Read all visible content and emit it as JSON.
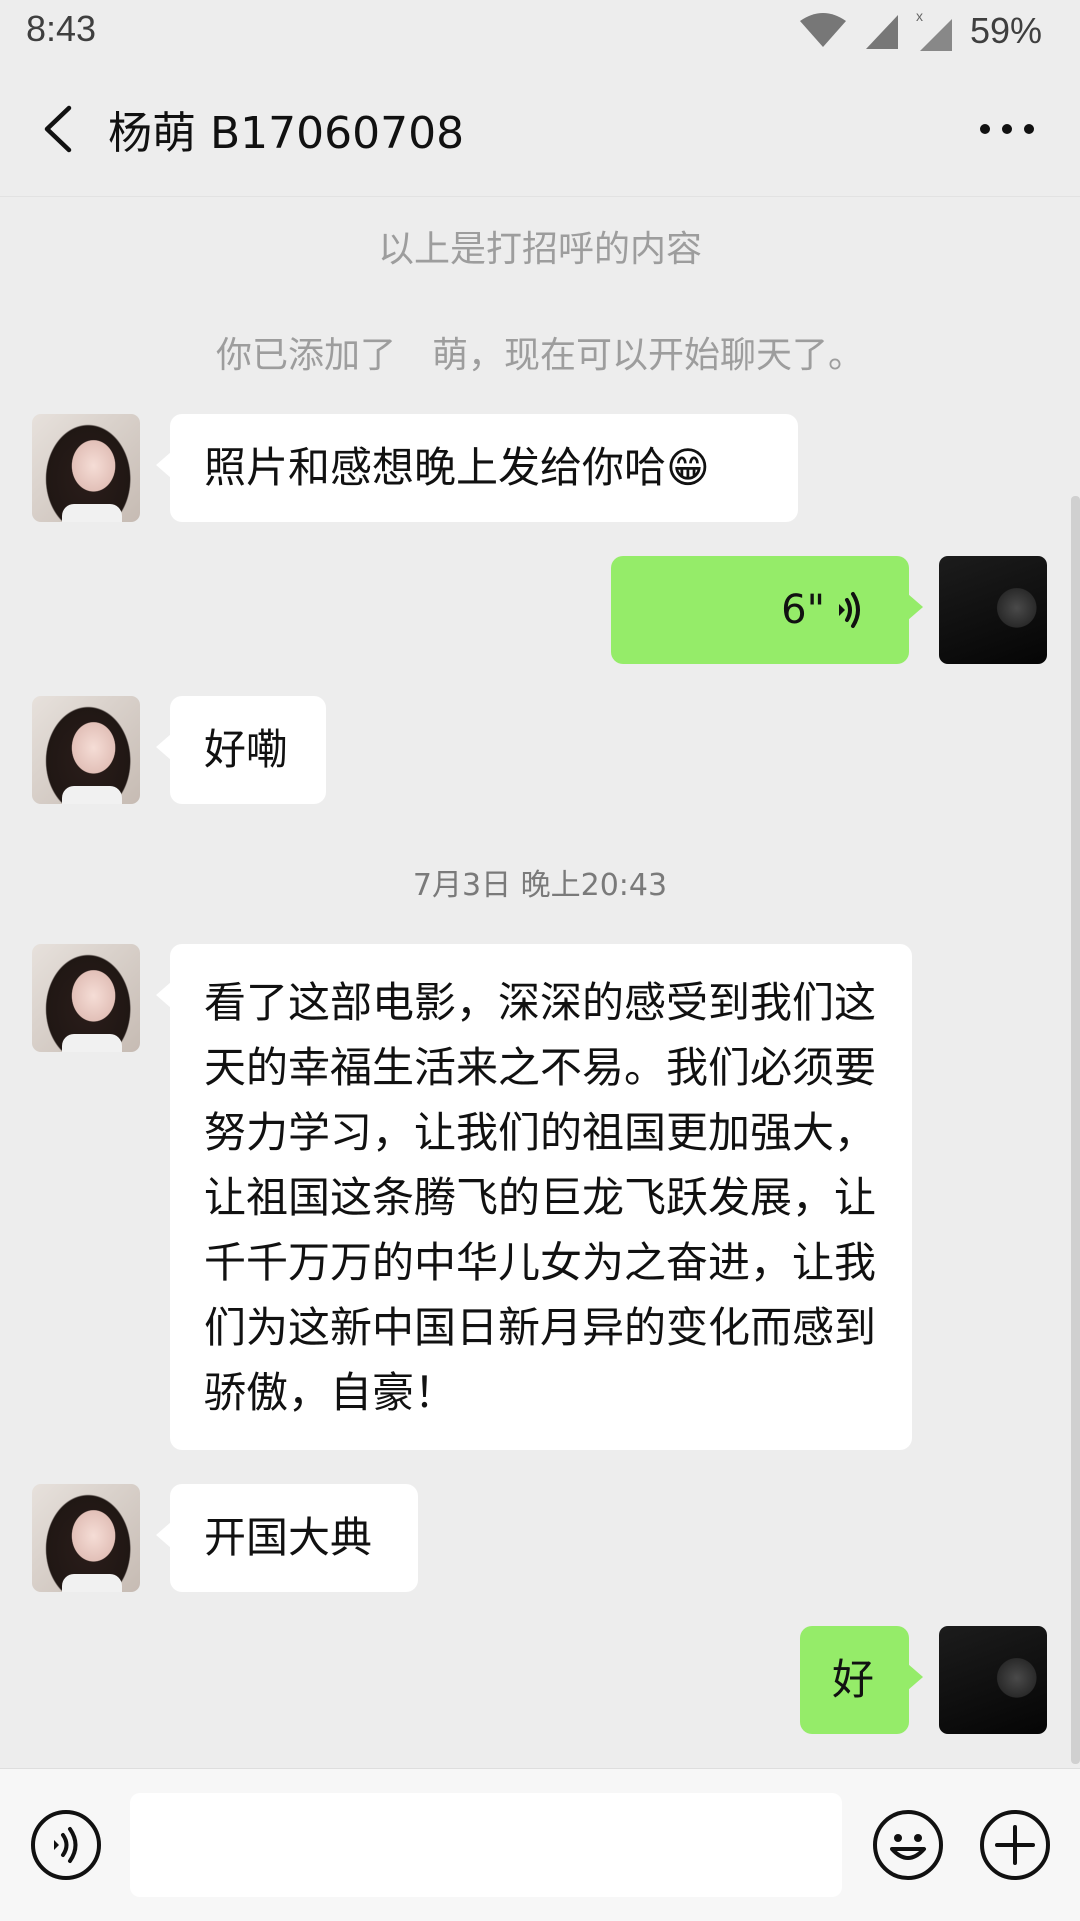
{
  "status_bar": {
    "time": "8:43",
    "battery": "59%"
  },
  "header": {
    "title": "杨萌 B17060708"
  },
  "system_notes": {
    "greeting_note": "以上是打招呼的内容",
    "added_note": "你已添加了　萌，现在可以开始聊天了。"
  },
  "timestamp": "7月3日 晚上20:43",
  "messages": [
    {
      "direction": "in",
      "type": "text",
      "text": "照片和感想晚上发给你哈😁"
    },
    {
      "direction": "out",
      "type": "voice",
      "duration": "6\""
    },
    {
      "direction": "in",
      "type": "text",
      "text": "好嘞"
    },
    {
      "direction": "in",
      "type": "text",
      "text": "看了这部电影，深深的感受到我们这天的幸福生活来之不易。我们必须要努力学习，让我们的祖国更加强大，让祖国这条腾飞的巨龙飞跃发展，让千千万万的中华儿女为之奋进，让我们为这新中国日新月异的变化而感到骄傲，自豪！"
    },
    {
      "direction": "in",
      "type": "text",
      "text": "开国大典"
    },
    {
      "direction": "out",
      "type": "text",
      "text": "好"
    }
  ],
  "input": {
    "placeholder": "",
    "value": ""
  },
  "colors": {
    "background": "#ededed",
    "outgoing_bubble": "#95ec69",
    "incoming_bubble": "#ffffff",
    "note_text": "#9d9d9d"
  },
  "icons": {
    "back": "chevron-left-icon",
    "more": "more-dots-icon",
    "voice": "voice-mode-icon",
    "emoji": "emoji-icon",
    "plus": "plus-icon",
    "wifi": "wifi-icon",
    "signal": "signal-icon",
    "voice_wave": "voice-wave-icon"
  }
}
